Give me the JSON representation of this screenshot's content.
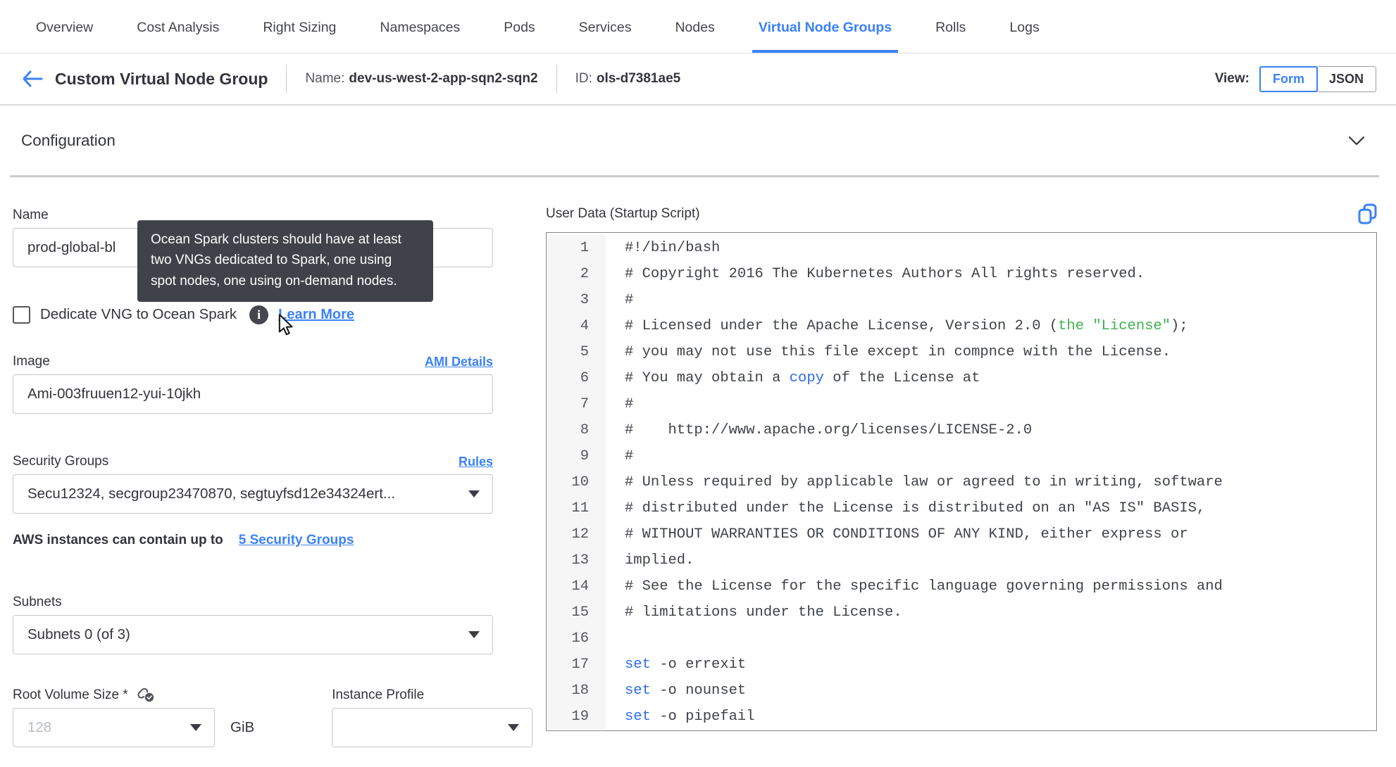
{
  "colors": {
    "accent": "#3b82f6",
    "tooltip_bg": "#404249",
    "code_green": "#3eb14b",
    "code_blue": "#2e6bf0"
  },
  "tabs": {
    "items": [
      "Overview",
      "Cost Analysis",
      "Right Sizing",
      "Namespaces",
      "Pods",
      "Services",
      "Nodes",
      "Virtual Node Groups",
      "Rolls",
      "Logs"
    ],
    "active": "Virtual Node Groups"
  },
  "header": {
    "title": "Custom Virtual Node Group",
    "name_label": "Name:",
    "name_value": "dev-us-west-2-app-sqn2-sqn2",
    "id_label": "ID:",
    "id_value": "ols-d7381ae5",
    "view_label": "View:",
    "view_options": [
      "Form",
      "JSON"
    ],
    "view_selected": "Form"
  },
  "section": {
    "title": "Configuration"
  },
  "form": {
    "name": {
      "label": "Name",
      "value": "prod-global-bl"
    },
    "tooltip_text": "Ocean Spark clusters should have at least two VNGs dedicated to Spark, one using spot nodes, one using on-demand nodes.",
    "dedicate": {
      "label": "Dedicate VNG to Ocean Spark",
      "link": "Learn More",
      "checked": false
    },
    "image": {
      "label": "Image",
      "link": "AMI Details",
      "value": "Ami-003fruuen12-yui-10jkh"
    },
    "security_groups": {
      "label": "Security Groups",
      "link": "Rules",
      "value": "Secu12324, secgroup23470870, segtuyfsd12e34324ert...",
      "helper_text": "AWS instances can contain up to",
      "helper_link": "5 Security Groups"
    },
    "subnets": {
      "label": "Subnets",
      "value": "Subnets 0 (of 3)"
    },
    "root_volume": {
      "label": "Root Volume Size *",
      "placeholder": "128",
      "unit": "GiB"
    },
    "instance_profile": {
      "label": "Instance Profile",
      "value": ""
    }
  },
  "editor": {
    "title": "User Data (Startup Script)",
    "lines": [
      {
        "num": 1,
        "segs": [
          {
            "t": "#!/bin/bash",
            "c": "plain"
          }
        ]
      },
      {
        "num": 2,
        "segs": [
          {
            "t": "# Copyright 2016 The Kubernetes Authors All rights reserved.",
            "c": "plain"
          }
        ]
      },
      {
        "num": 3,
        "segs": [
          {
            "t": "#",
            "c": "plain"
          }
        ]
      },
      {
        "num": 4,
        "segs": [
          {
            "t": "# Licensed under the Apache License, Version 2.0 (",
            "c": "plain"
          },
          {
            "t": "the \"License\"",
            "c": "green"
          },
          {
            "t": ");",
            "c": "plain"
          }
        ]
      },
      {
        "num": 5,
        "segs": [
          {
            "t": "# you may not use this file except in compnce with the License.",
            "c": "plain"
          }
        ]
      },
      {
        "num": 6,
        "segs": [
          {
            "t": "# You may obtain a ",
            "c": "plain"
          },
          {
            "t": "copy",
            "c": "blue"
          },
          {
            "t": " of the License at",
            "c": "plain"
          }
        ]
      },
      {
        "num": 7,
        "segs": [
          {
            "t": "#",
            "c": "plain"
          }
        ]
      },
      {
        "num": 8,
        "segs": [
          {
            "t": "#    http://www.apache.org/licenses/LICENSE-2.0",
            "c": "plain"
          }
        ]
      },
      {
        "num": 9,
        "segs": [
          {
            "t": "#",
            "c": "plain"
          }
        ]
      },
      {
        "num": 10,
        "segs": [
          {
            "t": "# Unless required by applicable law or agreed to in writing, software",
            "c": "plain"
          }
        ]
      },
      {
        "num": 11,
        "segs": [
          {
            "t": "# distributed under the License is distributed on an \"AS IS\" BASIS,",
            "c": "plain"
          }
        ]
      },
      {
        "num": 12,
        "segs": [
          {
            "t": "# WITHOUT WARRANTIES OR CONDITIONS OF ANY KIND, either express or",
            "c": "plain"
          }
        ]
      },
      {
        "num": 13,
        "segs": [
          {
            "t": "implied.",
            "c": "plain"
          }
        ]
      },
      {
        "num": 14,
        "segs": [
          {
            "t": "# See the License for the specific language governing permissions and",
            "c": "plain"
          }
        ]
      },
      {
        "num": 15,
        "segs": [
          {
            "t": "# limitations under the License.",
            "c": "plain"
          }
        ]
      },
      {
        "num": 16,
        "segs": [
          {
            "t": "",
            "c": "plain"
          }
        ]
      },
      {
        "num": 17,
        "segs": [
          {
            "t": "set",
            "c": "blue"
          },
          {
            "t": " -o errexit",
            "c": "plain"
          }
        ]
      },
      {
        "num": 18,
        "segs": [
          {
            "t": "set",
            "c": "blue"
          },
          {
            "t": " -o nounset",
            "c": "plain"
          }
        ]
      },
      {
        "num": 19,
        "segs": [
          {
            "t": "set",
            "c": "blue"
          },
          {
            "t": " -o pipefail",
            "c": "plain"
          }
        ]
      }
    ]
  }
}
